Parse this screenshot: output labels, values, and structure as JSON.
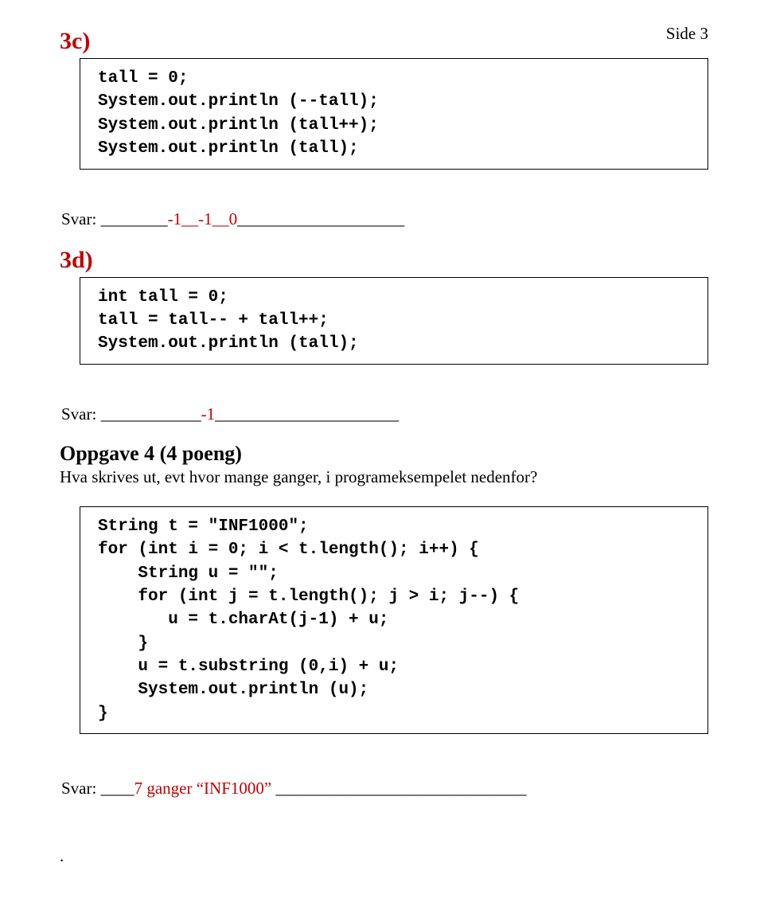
{
  "header": {
    "page_label": "Side 3"
  },
  "q3c": {
    "label": "3c)",
    "code": "tall = 0;\nSystem.out.println (--tall);\nSystem.out.println (tall++);\nSystem.out.println (tall);",
    "svar_prefix": "Svar: ________",
    "svar_answer": "-1__-1__0",
    "svar_suffix": "____________________"
  },
  "q3d": {
    "label": "3d)",
    "code": "int tall = 0;\ntall = tall-- + tall++;\nSystem.out.println (tall);",
    "svar_prefix": "Svar: ____________",
    "svar_answer": "-1",
    "svar_suffix": "______________________"
  },
  "q4": {
    "heading": "Oppgave 4 (4 poeng)",
    "desc": "Hva skrives ut, evt hvor mange ganger, i programeksempelet nedenfor?",
    "code": "String t = \"INF1000\";\nfor (int i = 0; i < t.length(); i++) {\n    String u = \"\";\n    for (int j = t.length(); j > i; j--) {\n       u = t.charAt(j-1) + u;\n    }\n    u = t.substring (0,i) + u;\n    System.out.println (u);\n}",
    "svar_prefix": "Svar: ____",
    "svar_answer": "7 ganger “INF1000” ",
    "svar_suffix": "______________________________"
  },
  "footer_dot": "."
}
